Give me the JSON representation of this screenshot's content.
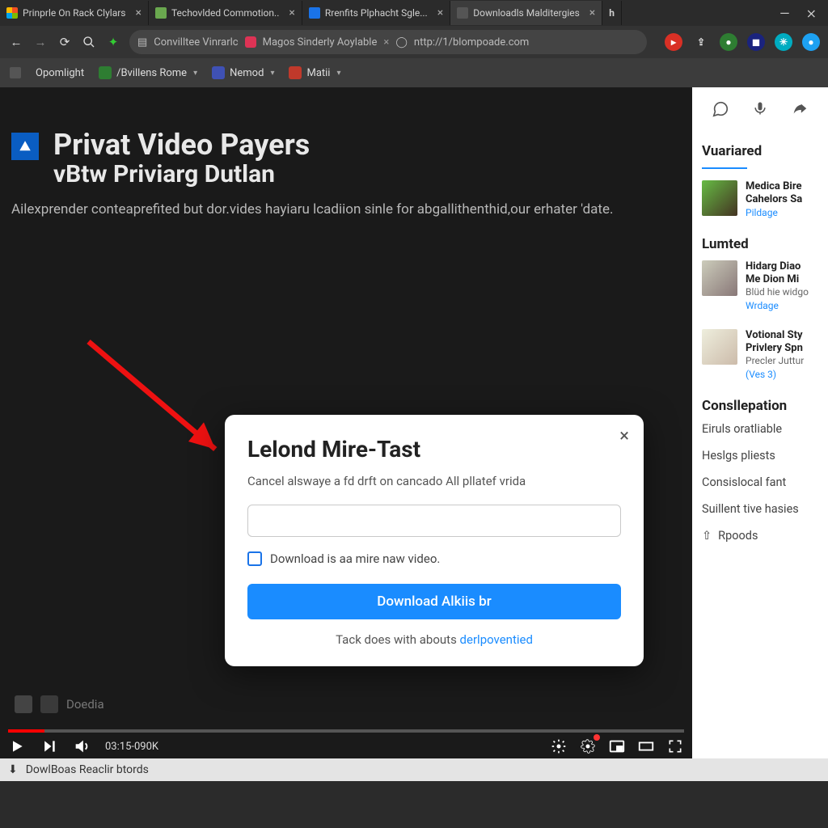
{
  "tabs": [
    {
      "title": "Prinprle On Rack Clylars",
      "favcolor": "linear-gradient(45deg,#f25022,#7fba00,#00a4ef,#ffb900)"
    },
    {
      "title": "Techovlded Commotion..",
      "favcolor": "#6aa84f"
    },
    {
      "title": "Rrenfits Plphacht Sgle...",
      "favcolor": "#1a73e8"
    },
    {
      "title": "Downloadls Malditergies",
      "favcolor": "#555",
      "active": true
    }
  ],
  "omnibox": {
    "lock": "⎆",
    "seg1": "Convilltee Vinrarlc",
    "seg2": "Magos Sinderly Aoylable",
    "url": "nttp://1/blompoade.com"
  },
  "bookmarks": [
    {
      "label": "Opomlight",
      "fav": "#f28b1c"
    },
    {
      "label": "/Bvillens Rome",
      "fav": "#2e7d32",
      "menu": true
    },
    {
      "label": "Nemod",
      "fav": "#3f51b5",
      "menu": true
    },
    {
      "label": "Matii",
      "fav": "#c0392b",
      "menu": true
    }
  ],
  "page": {
    "title": "Privat Video Payers",
    "subtitle": "vBtw Priviarg Dutlan",
    "desc": "Ailexprender conteaprefited but dor.vides hayiaru lcadiion sinle for abgallithenthid,our erhater 'date."
  },
  "dialog": {
    "title": "Lelond Mire-Tast",
    "body": "Cancel alswaye a fd drft on cancado All pllatef vrida",
    "placeholder": "",
    "checkbox": "Download is aa mire naw video.",
    "button": "Download Alkiis br",
    "foot_pre": "Tack does with abouts ",
    "foot_link": "derlpoventied"
  },
  "sidebar": {
    "h1": "Vuariared",
    "card1": {
      "t": "Medica Bire",
      "t2": "Cahelors Sa",
      "s": "Pildage"
    },
    "h2": "Lumted",
    "card2": {
      "t": "Hidarg Diao",
      "t2": "Me Dion Mi",
      "s1": "Blüd hie widgo",
      "s2": "Wrdage"
    },
    "card3": {
      "t": "Votional Sty",
      "t2": "Privlery Spn",
      "s1": "Precler Juttur",
      "s2": "(Ves 3)"
    },
    "h3": "Consllepation",
    "items": [
      "Eiruls oratliable",
      "Heslgs pliests",
      "Consislocal fant",
      "Suillent tive hasies"
    ],
    "rp": "Rpoods"
  },
  "player": {
    "watermark": "Doedia",
    "time": "03:15-090K"
  },
  "status": {
    "text": "DowlBoas Reaclir btords"
  }
}
